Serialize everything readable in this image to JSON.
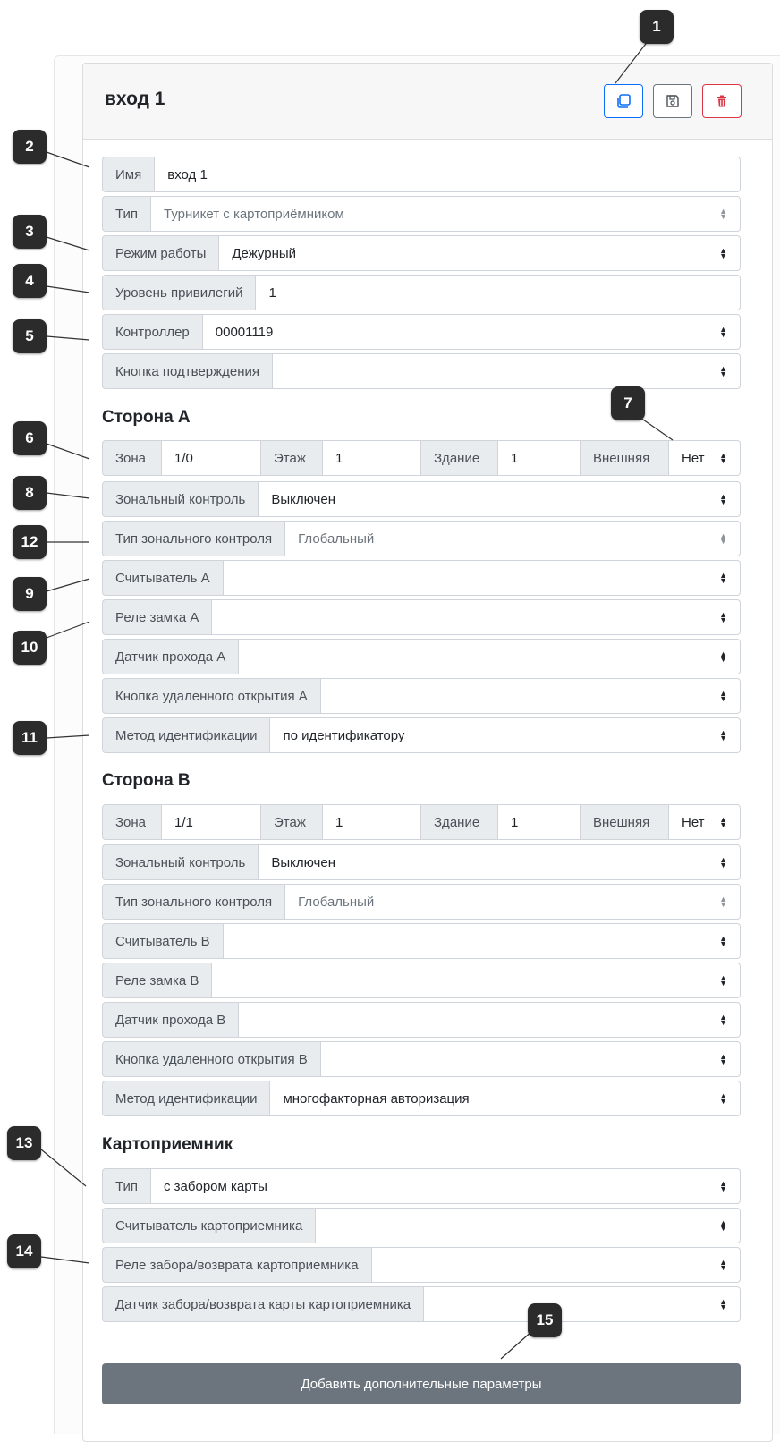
{
  "header": {
    "title": "вход 1"
  },
  "toolbar": {
    "copy_icon": "copy-icon",
    "save_icon": "save-icon",
    "delete_icon": "trash-icon"
  },
  "colors": {
    "primary": "#0d6efd",
    "secondary": "#6c757d",
    "danger": "#dc3545",
    "callout": "#2b2b2b"
  },
  "general": {
    "name": {
      "label": "Имя",
      "value": "вход 1"
    },
    "type": {
      "label": "Тип",
      "value": "Турникет с картоприёмником"
    },
    "mode": {
      "label": "Режим работы",
      "value": "Дежурный"
    },
    "privilege": {
      "label": "Уровень привилегий",
      "value": "1"
    },
    "controller": {
      "label": "Контроллер",
      "value": "00001119"
    },
    "confirm_button": {
      "label": "Кнопка подтверждения",
      "value": ""
    }
  },
  "side_a": {
    "title": "Сторона А",
    "zone_label": "Зона",
    "zone_value": "1/0",
    "floor_label": "Этаж",
    "floor_value": "1",
    "building_label": "Здание",
    "building_value": "1",
    "external_label": "Внешняя",
    "external_value": "Нет",
    "zonal_control": {
      "label": "Зональный контроль",
      "value": "Выключен"
    },
    "zonal_type": {
      "label": "Тип зонального контроля",
      "value": "Глобальный"
    },
    "reader": {
      "label": "Считыватель А",
      "value": ""
    },
    "lock_relay": {
      "label": "Реле замка А",
      "value": ""
    },
    "pass_sensor": {
      "label": "Датчик прохода А",
      "value": ""
    },
    "remote_button": {
      "label": "Кнопка удаленного открытия А",
      "value": ""
    },
    "ident_method": {
      "label": "Метод идентификации",
      "value": "по идентификатору"
    }
  },
  "side_b": {
    "title": "Сторона В",
    "zone_label": "Зона",
    "zone_value": "1/1",
    "floor_label": "Этаж",
    "floor_value": "1",
    "building_label": "Здание",
    "building_value": "1",
    "external_label": "Внешняя",
    "external_value": "Нет",
    "zonal_control": {
      "label": "Зональный контроль",
      "value": "Выключен"
    },
    "zonal_type": {
      "label": "Тип зонального контроля",
      "value": "Глобальный"
    },
    "reader": {
      "label": "Считыватель В",
      "value": ""
    },
    "lock_relay": {
      "label": "Реле замка В",
      "value": ""
    },
    "pass_sensor": {
      "label": "Датчик прохода В",
      "value": ""
    },
    "remote_button": {
      "label": "Кнопка удаленного открытия В",
      "value": ""
    },
    "ident_method": {
      "label": "Метод идентификации",
      "value": "многофакторная авторизация"
    }
  },
  "card_acceptor": {
    "title": "Картоприемник",
    "type": {
      "label": "Тип",
      "value": "с забором карты"
    },
    "reader": {
      "label": "Считыватель картоприемника",
      "value": ""
    },
    "relay": {
      "label": "Реле забора/возврата картоприемника",
      "value": ""
    },
    "sensor": {
      "label": "Датчик забора/возврата карты картоприемника",
      "value": ""
    }
  },
  "add_button": "Добавить дополнительные параметры",
  "callouts": [
    "1",
    "2",
    "3",
    "4",
    "5",
    "6",
    "7",
    "8",
    "9",
    "10",
    "11",
    "12",
    "13",
    "14",
    "15"
  ]
}
